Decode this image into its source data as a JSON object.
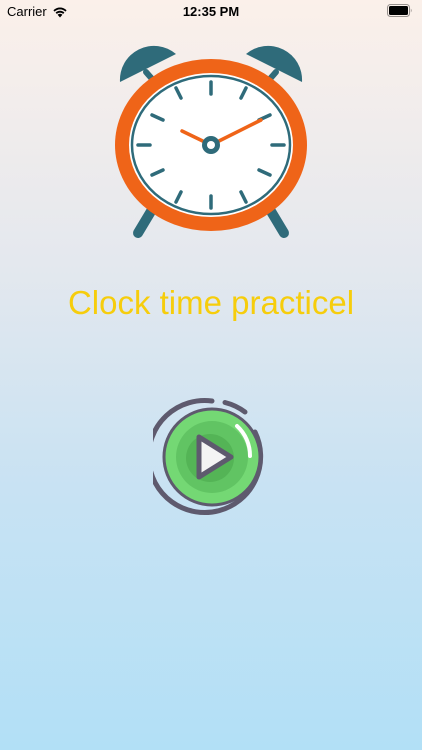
{
  "status_bar": {
    "carrier": "Carrier",
    "time": "12:35 PM",
    "wifi_icon": "wifi-icon",
    "battery_icon": "battery-icon"
  },
  "main": {
    "clock_icon": "alarm-clock-icon",
    "title": "Clock time practicel",
    "play_icon": "play-icon"
  },
  "colors": {
    "title": "#f6cd0c",
    "clock_ring": "#ef6418",
    "clock_bells": "#2f6b7a",
    "play_green": "#74d874",
    "play_ring": "#5e5a6e"
  }
}
